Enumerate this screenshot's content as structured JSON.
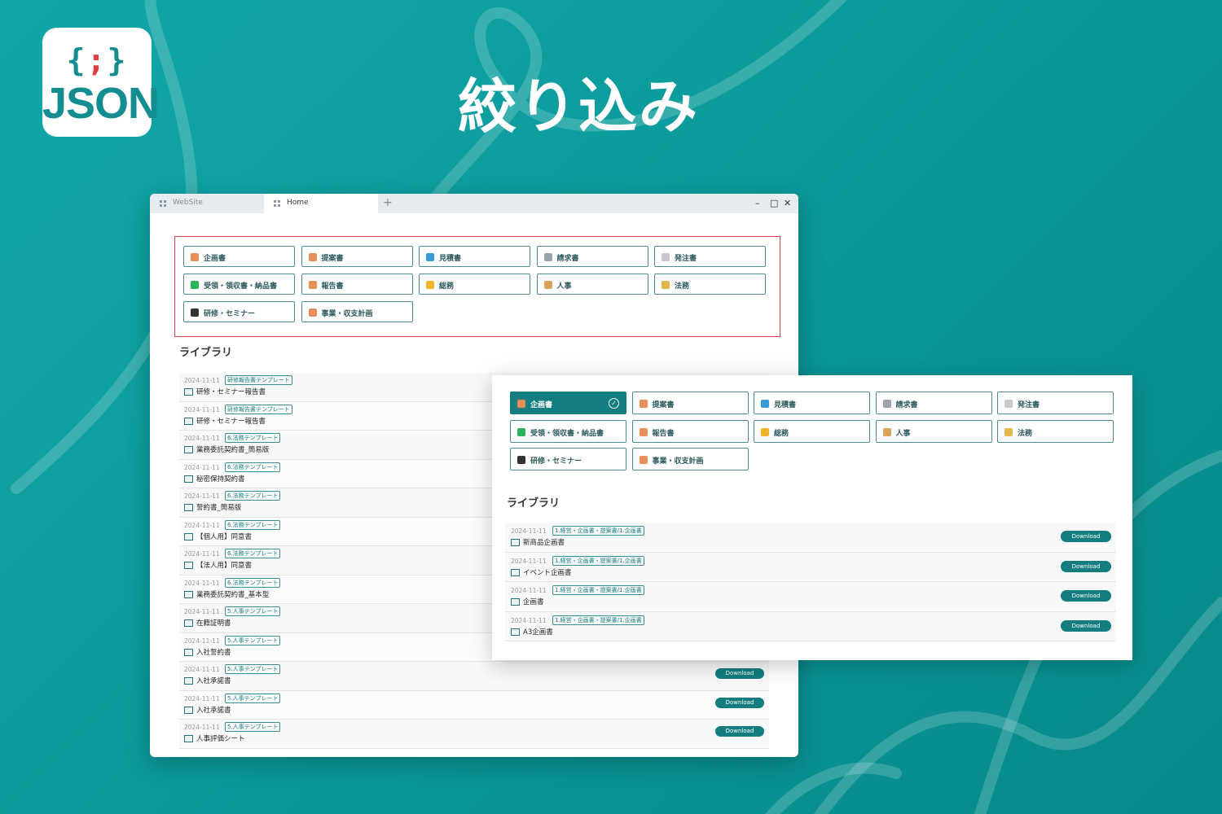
{
  "logo": {
    "brace": "{;}",
    "brace_left": "{",
    "semicolon": ";",
    "brace_right": "}",
    "word": "JSON"
  },
  "headline": "絞り込み",
  "browser": {
    "tabs": [
      "WebSite",
      "Home"
    ],
    "new_tab": "+",
    "controls": {
      "minimize": "–",
      "maximize": "□",
      "close": "✕"
    }
  },
  "categories": [
    {
      "label": "企画書",
      "icon": "pencil-doc-icon",
      "color": "#e8905a"
    },
    {
      "label": "提案書",
      "icon": "pencil-doc-icon",
      "color": "#e8905a"
    },
    {
      "label": "見積書",
      "icon": "monitor-icon",
      "color": "#3a9ad9"
    },
    {
      "label": "請求書",
      "icon": "receipt-icon",
      "color": "#9aa3aa"
    },
    {
      "label": "発注書",
      "icon": "order-doc-icon",
      "color": "#c8c8d0"
    },
    {
      "label": "受領・領収書・納品書",
      "icon": "check-icon",
      "color": "#2bb35a"
    },
    {
      "label": "報告書",
      "icon": "pencil-doc-icon",
      "color": "#e8905a"
    },
    {
      "label": "総務",
      "icon": "folder-icon",
      "color": "#f0b429"
    },
    {
      "label": "人事",
      "icon": "person-icon",
      "color": "#d9a45a"
    },
    {
      "label": "法務",
      "icon": "scales-icon",
      "color": "#e2b84a"
    },
    {
      "label": "研修・セミナー",
      "icon": "graduation-cap-icon",
      "color": "#333333"
    },
    {
      "label": "事業・収支計画",
      "icon": "clipboard-icon",
      "color": "#e8905a"
    }
  ],
  "library_title": "ライブラリ",
  "download_label": "Download",
  "back_rows": [
    {
      "date": "2024-11-11",
      "tag": "研修報告書テンプレート",
      "name": "研修・セミナー報告書",
      "download": false
    },
    {
      "date": "2024-11-11",
      "tag": "研修報告書テンプレート",
      "name": "研修・セミナー報告書",
      "download": false
    },
    {
      "date": "2024-11-11",
      "tag": "6.法務テンプレート",
      "name": "業務委託契約書_簡易版",
      "download": false
    },
    {
      "date": "2024-11-11",
      "tag": "6.法務テンプレート",
      "name": "秘密保持契約書",
      "download": false
    },
    {
      "date": "2024-11-11",
      "tag": "6.法務テンプレート",
      "name": "誓約書_簡易版",
      "download": false
    },
    {
      "date": "2024-11-11",
      "tag": "6.法務テンプレート",
      "name": "【個人用】同意書",
      "download": false
    },
    {
      "date": "2024-11-11",
      "tag": "6.法務テンプレート",
      "name": "【法人用】同意書",
      "download": false
    },
    {
      "date": "2024-11-11",
      "tag": "6.法務テンプレート",
      "name": "業務委託契約書_基本型",
      "download": false
    },
    {
      "date": "2024-11-11",
      "tag": "5.人事テンプレート",
      "name": "在籍証明書",
      "download": false
    },
    {
      "date": "2024-11-11",
      "tag": "5.人事テンプレート",
      "name": "入社誓約書",
      "download": false
    },
    {
      "date": "2024-11-11",
      "tag": "5.人事テンプレート",
      "name": "入社承諾書",
      "download": true
    },
    {
      "date": "2024-11-11",
      "tag": "5.人事テンプレート",
      "name": "入社承諾書",
      "download": true
    },
    {
      "date": "2024-11-11",
      "tag": "5.人事テンプレート",
      "name": "人事評価シート",
      "download": true
    }
  ],
  "front_active_index": 0,
  "front_rows": [
    {
      "date": "2024-11-11",
      "tag": "1.経営・企画書・提案書/1.企画書",
      "name": "新商品企画書"
    },
    {
      "date": "2024-11-11",
      "tag": "1.経営・企画書・提案書/1.企画書",
      "name": "イベント企画書"
    },
    {
      "date": "2024-11-11",
      "tag": "1.経営・企画書・提案書/1.企画書",
      "name": "企画書"
    },
    {
      "date": "2024-11-11",
      "tag": "1.経営・企画書・提案書/1.企画書",
      "name": "A3企画書"
    }
  ]
}
